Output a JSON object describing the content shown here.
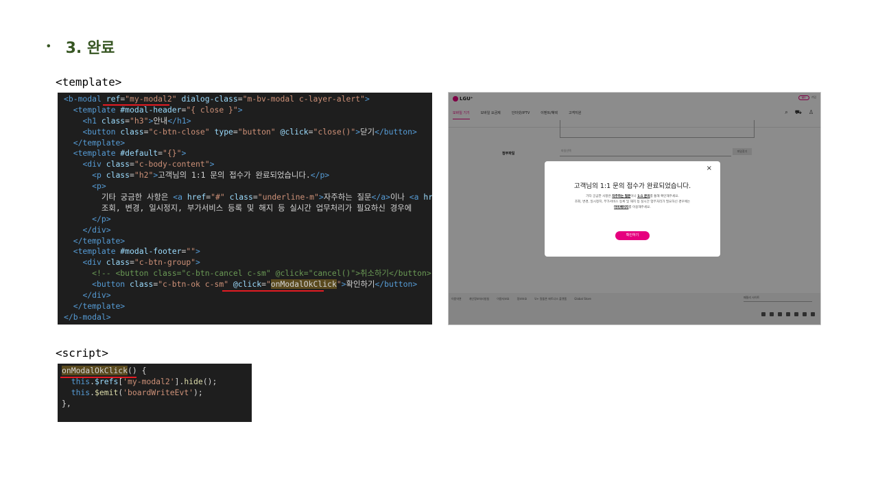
{
  "slide": {
    "bullet": "•",
    "title": "3. 완료",
    "template_label": "<template>",
    "script_label": "<script>"
  },
  "code_template": {
    "lines": [
      [
        [
          "t",
          "<b-modal "
        ],
        [
          "a",
          "ref"
        ],
        [
          "x",
          "="
        ],
        [
          "s",
          "\"my-modal2\""
        ],
        [
          "a",
          " dialog-class"
        ],
        [
          "x",
          "="
        ],
        [
          "s",
          "\"m-bv-modal c-layer-alert\""
        ],
        [
          "t",
          ">"
        ]
      ],
      [
        [
          "x",
          "  "
        ],
        [
          "t",
          "<template "
        ],
        [
          "a",
          "#modal-header"
        ],
        [
          "x",
          "="
        ],
        [
          "s",
          "\"{ close }\""
        ],
        [
          "t",
          ">"
        ]
      ],
      [
        [
          "x",
          "    "
        ],
        [
          "t",
          "<h1 "
        ],
        [
          "a",
          "class"
        ],
        [
          "x",
          "="
        ],
        [
          "s",
          "\"h3\""
        ],
        [
          "t",
          ">"
        ],
        [
          "x",
          "안내"
        ],
        [
          "t",
          "</h1>"
        ]
      ],
      [
        [
          "x",
          "    "
        ],
        [
          "t",
          "<button "
        ],
        [
          "a",
          "class"
        ],
        [
          "x",
          "="
        ],
        [
          "s",
          "\"c-btn-close\""
        ],
        [
          "a",
          " type"
        ],
        [
          "x",
          "="
        ],
        [
          "s",
          "\"button\""
        ],
        [
          "a",
          " @click"
        ],
        [
          "x",
          "="
        ],
        [
          "s",
          "\"close()\""
        ],
        [
          "t",
          ">"
        ],
        [
          "x",
          "닫기"
        ],
        [
          "t",
          "</button>"
        ]
      ],
      [
        [
          "x",
          "  "
        ],
        [
          "t",
          "</template>"
        ]
      ],
      [
        [
          "x",
          "  "
        ],
        [
          "t",
          "<template "
        ],
        [
          "a",
          "#default"
        ],
        [
          "x",
          "="
        ],
        [
          "s",
          "\"{}\""
        ],
        [
          "t",
          ">"
        ]
      ],
      [
        [
          "x",
          "    "
        ],
        [
          "t",
          "<div "
        ],
        [
          "a",
          "class"
        ],
        [
          "x",
          "="
        ],
        [
          "s",
          "\"c-body-content\""
        ],
        [
          "t",
          ">"
        ]
      ],
      [
        [
          "x",
          "      "
        ],
        [
          "t",
          "<p "
        ],
        [
          "a",
          "class"
        ],
        [
          "x",
          "="
        ],
        [
          "s",
          "\"h2\""
        ],
        [
          "t",
          ">"
        ],
        [
          "x",
          "고객님의 1:1 문의 접수가 완료되었습니다."
        ],
        [
          "t",
          "</p>"
        ]
      ],
      [
        [
          "x",
          "      "
        ],
        [
          "t",
          "<p>"
        ]
      ],
      [
        [
          "x",
          "        기타 궁금한 사항은 "
        ],
        [
          "t",
          "<a "
        ],
        [
          "a",
          "href"
        ],
        [
          "x",
          "="
        ],
        [
          "s",
          "\"#\""
        ],
        [
          "a",
          " class"
        ],
        [
          "x",
          "="
        ],
        [
          "s",
          "\"underline-m\""
        ],
        [
          "t",
          ">"
        ],
        [
          "x",
          "자주하는 질문"
        ],
        [
          "t",
          "</a>"
        ],
        [
          "x",
          "이나 "
        ],
        [
          "t",
          "<a "
        ],
        [
          "a",
          "hre"
        ]
      ],
      [
        [
          "x",
          "        조회, 변경, 일시정지, 부가서비스 등록 및 해지 등 실시간 업무처리가 필요하신 경우에"
        ]
      ],
      [
        [
          "x",
          "      "
        ],
        [
          "t",
          "</p>"
        ]
      ],
      [
        [
          "x",
          "    "
        ],
        [
          "t",
          "</div>"
        ]
      ],
      [
        [
          "x",
          "  "
        ],
        [
          "t",
          "</template>"
        ]
      ],
      [
        [
          "x",
          "  "
        ],
        [
          "t",
          "<template "
        ],
        [
          "a",
          "#modal-footer"
        ],
        [
          "x",
          "="
        ],
        [
          "s",
          "\"\""
        ],
        [
          "t",
          ">"
        ]
      ],
      [
        [
          "x",
          "    "
        ],
        [
          "t",
          "<div "
        ],
        [
          "a",
          "class"
        ],
        [
          "x",
          "="
        ],
        [
          "s",
          "\"c-btn-group\""
        ],
        [
          "t",
          ">"
        ]
      ],
      [
        [
          "x",
          "      "
        ],
        [
          "c",
          "<!-- <button class=\"c-btn-cancel c-sm\" @click=\"cancel()\">취소하기</button> -->"
        ]
      ],
      [
        [
          "x",
          "      "
        ],
        [
          "t",
          "<button "
        ],
        [
          "a",
          "class"
        ],
        [
          "x",
          "="
        ],
        [
          "s",
          "\"c-btn-ok c-sm\""
        ],
        [
          "x",
          " "
        ],
        [
          "a",
          "@click"
        ],
        [
          "x",
          "="
        ],
        [
          "s",
          "\""
        ],
        [
          "hl",
          "onModalOkClick"
        ],
        [
          "s",
          "\""
        ],
        [
          "t",
          ">"
        ],
        [
          "x",
          "확인하기"
        ],
        [
          "t",
          "</button>"
        ]
      ],
      [
        [
          "x",
          "    "
        ],
        [
          "t",
          "</div>"
        ]
      ],
      [
        [
          "x",
          "  "
        ],
        [
          "t",
          "</template>"
        ]
      ],
      [
        [
          "t",
          "</b-modal>"
        ]
      ]
    ]
  },
  "code_script": {
    "lines": [
      [
        [
          "hl",
          "onModalOkClick"
        ],
        [
          "x",
          "() {"
        ]
      ],
      [
        [
          "x",
          "  "
        ],
        [
          "k",
          "this"
        ],
        [
          "x",
          "."
        ],
        [
          "a",
          "$refs"
        ],
        [
          "x",
          "["
        ],
        [
          "s",
          "'my-modal2'"
        ],
        [
          "x",
          "]."
        ],
        [
          "f",
          "hide"
        ],
        [
          "x",
          "();"
        ]
      ],
      [
        [
          "x",
          "  "
        ],
        [
          "k",
          "this"
        ],
        [
          "x",
          "."
        ],
        [
          "f",
          "$emit"
        ],
        [
          "x",
          "("
        ],
        [
          "s",
          "'boardWriteEvt'"
        ],
        [
          "x",
          ");"
        ]
      ],
      [
        [
          "x",
          "},"
        ]
      ]
    ]
  },
  "screenshot": {
    "logo": "LGU⁺",
    "top_links": [
      "MY",
      "가입"
    ],
    "nav": [
      "모바일 기기",
      "모바일 요금제",
      "인터넷/IPTV",
      "이벤트/혜택",
      "고객지원"
    ],
    "file_label": "첨부파일",
    "file_placeholder": "파일선택",
    "file_button": "파일찾기",
    "modal_close": "×",
    "modal_title": "고객님의 1:1 문의 접수가 완료되었습니다.",
    "modal_body_1a": "기타 궁금한 사항은 ",
    "modal_body_1b": "자주하는 질문",
    "modal_body_1c": "이나 ",
    "modal_body_1d": "1:1 문의",
    "modal_body_1e": "를 통해 확인해주세요.",
    "modal_body_2": "조회, 변경, 일시정지, 부가서비스 등록 및 해지 등 실시간 업무처리가 필요하신 경우에는",
    "modal_body_3a": "마이페이지",
    "modal_body_3b": "를 이용해주세요.",
    "ok_button": "확인하기",
    "footer_links": [
      "이용약관",
      "개인정보처리방침",
      "이용자보호",
      "정보보호",
      "U+ 알뜰폰 파트너스 플랫폼",
      "Global Store"
    ],
    "family_site": "패밀리 사이트"
  }
}
